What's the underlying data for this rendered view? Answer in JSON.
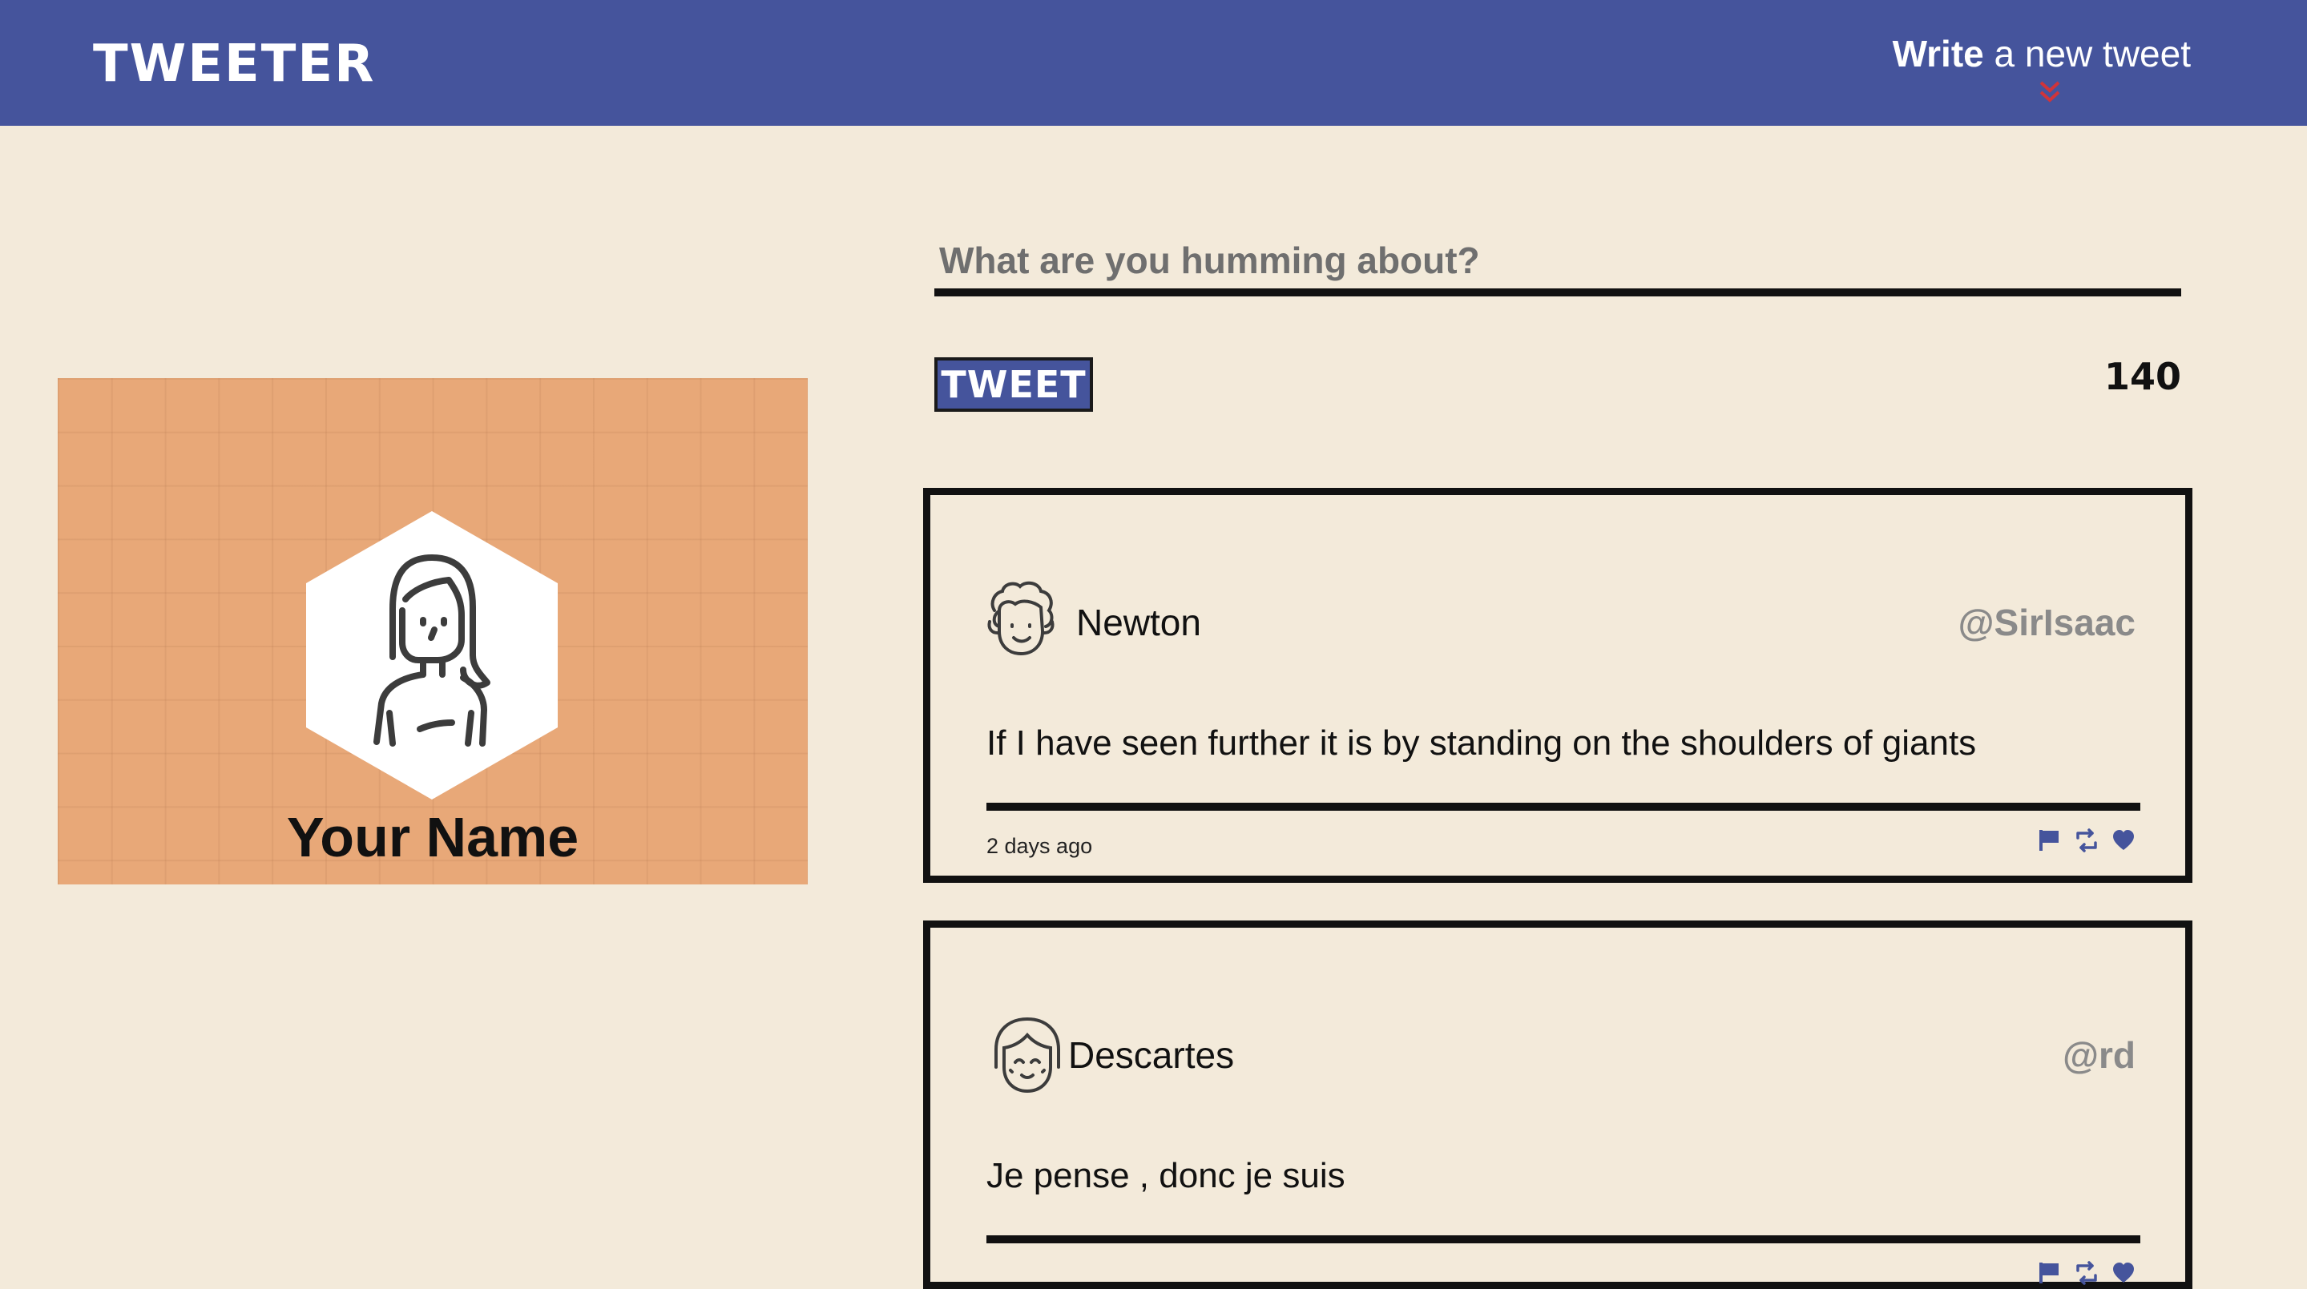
{
  "nav": {
    "brand": "TWEETER",
    "compose_bold": "Write",
    "compose_rest": " a new tweet",
    "chevron_icon": "double-chevron-down-icon",
    "accent": "#45549c",
    "chevron_color": "#d0343a"
  },
  "profile": {
    "name": "Your Name",
    "avatar_icon": "woman-avatar-icon",
    "background": "#e8a878"
  },
  "compose": {
    "placeholder": "What are you humming about?",
    "button_label": "TWEET",
    "counter": "140"
  },
  "tweets": [
    {
      "name": "Newton",
      "handle": "@SirIsaac",
      "avatar_icon": "curly-hair-avatar-icon",
      "content": "If I have seen further it is by standing on the shoulders of giants",
      "timestamp": "2 days ago",
      "actions": [
        "flag-icon",
        "retweet-icon",
        "heart-icon"
      ]
    },
    {
      "name": "Descartes",
      "handle": "@rd",
      "avatar_icon": "bob-hair-avatar-icon",
      "content": "Je pense , donc je suis",
      "timestamp": "",
      "actions": [
        "flag-icon",
        "retweet-icon",
        "heart-icon"
      ]
    }
  ]
}
